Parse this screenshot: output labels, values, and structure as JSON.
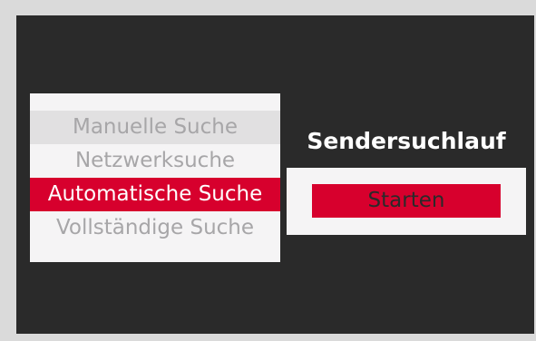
{
  "menu": {
    "items": [
      {
        "label": "Manuelle Suche"
      },
      {
        "label": "Netzwerksuche"
      },
      {
        "label": "Automatische Suche"
      },
      {
        "label": "Vollständige Suche"
      }
    ],
    "selected": "Automatische Suche"
  },
  "title": "Sendersuchlauf",
  "panel": {
    "start_label": "Starten"
  },
  "colors": {
    "accent": "#d7002d",
    "screen_background": "#2a2a2a",
    "frame": "#dadada",
    "panel": "#f5f4f5",
    "inactive_text": "#a7a6a8",
    "focused_row": "#e1e0e1"
  }
}
